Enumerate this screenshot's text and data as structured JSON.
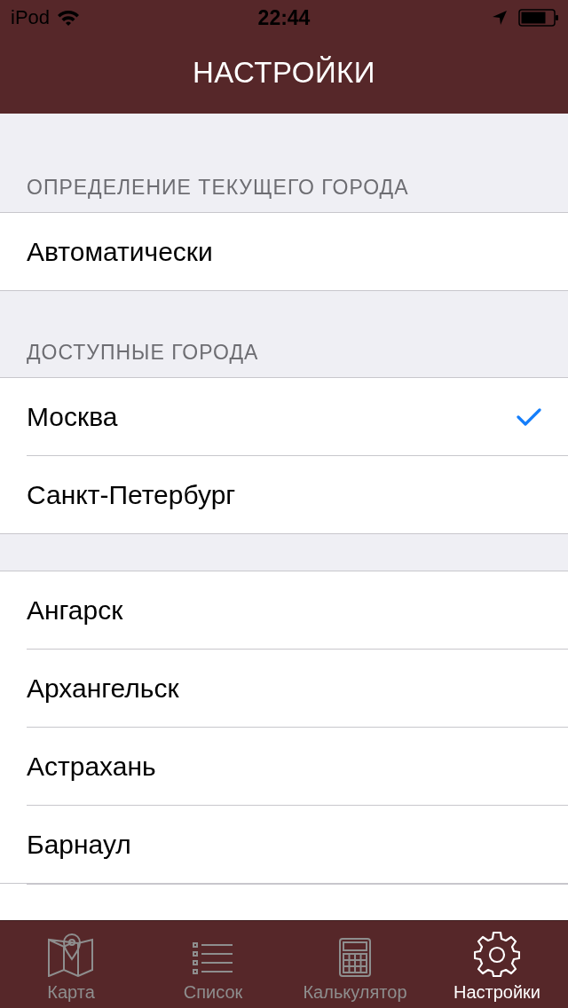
{
  "status_bar": {
    "carrier": "iPod",
    "time": "22:44"
  },
  "nav_bar": {
    "title": "НАСТРОЙКИ"
  },
  "sections": [
    {
      "header": "ОПРЕДЕЛЕНИЕ ТЕКУЩЕГО ГОРОДА",
      "items": [
        {
          "label": "Автоматически",
          "selected": false
        }
      ]
    },
    {
      "header": "ДОСТУПНЫЕ ГОРОДА",
      "items": [
        {
          "label": "Москва",
          "selected": true
        },
        {
          "label": "Санкт-Петербург",
          "selected": false
        }
      ]
    },
    {
      "items": [
        {
          "label": "Ангарск",
          "selected": false
        },
        {
          "label": "Архангельск",
          "selected": false
        },
        {
          "label": "Астрахань",
          "selected": false
        },
        {
          "label": "Барнаул",
          "selected": false
        }
      ]
    }
  ],
  "tab_bar": [
    {
      "kind": "map",
      "label": "Карта",
      "selected": false
    },
    {
      "kind": "list",
      "label": "Список",
      "selected": false
    },
    {
      "kind": "calculator",
      "label": "Калькулятор",
      "selected": false
    },
    {
      "kind": "settings",
      "label": "Настройки",
      "selected": true
    }
  ]
}
